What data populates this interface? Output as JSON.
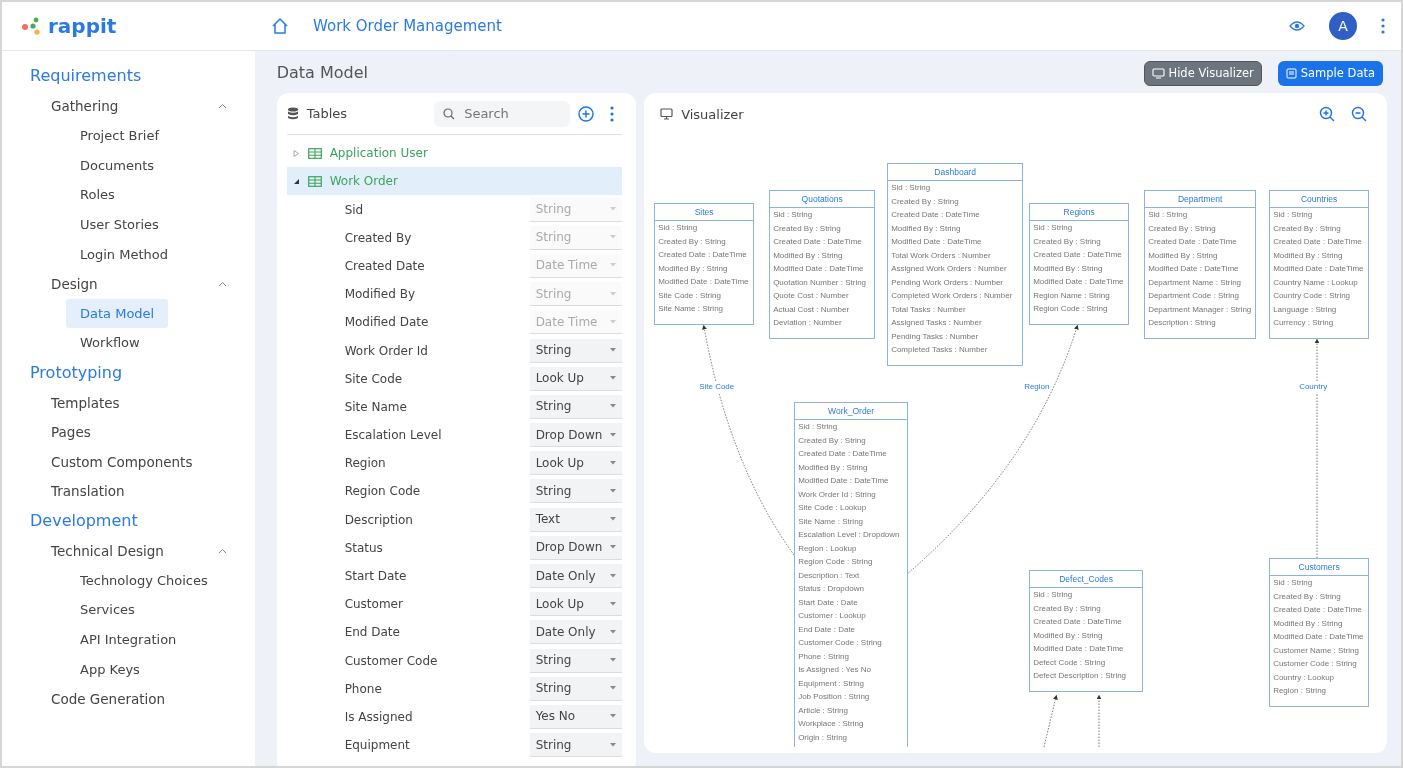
{
  "app": {
    "brand": "rappit",
    "project": "Work Order Management",
    "avatar": "A"
  },
  "sidebar": {
    "sections": [
      {
        "title": "Requirements",
        "items": [
          {
            "label": "Gathering",
            "expanded": true,
            "children": [
              {
                "label": "Project Brief",
                "selected": false
              },
              {
                "label": "Documents",
                "selected": false
              },
              {
                "label": "Roles",
                "selected": false
              },
              {
                "label": "User Stories",
                "selected": false
              },
              {
                "label": "Login Method",
                "selected": false
              }
            ]
          },
          {
            "label": "Design",
            "expanded": true,
            "children": [
              {
                "label": "Data Model",
                "selected": true
              },
              {
                "label": "Workflow",
                "selected": false
              }
            ]
          }
        ]
      },
      {
        "title": "Prototyping",
        "items": [
          {
            "label": "Templates",
            "selected": false
          },
          {
            "label": "Pages",
            "selected": false
          },
          {
            "label": "Custom Components",
            "selected": false
          },
          {
            "label": "Translation",
            "selected": false
          }
        ]
      },
      {
        "title": "Development",
        "items": [
          {
            "label": "Technical Design",
            "expanded": true,
            "children": [
              {
                "label": "Technology Choices",
                "selected": false
              },
              {
                "label": "Services",
                "selected": false
              },
              {
                "label": "API Integration",
                "selected": false
              },
              {
                "label": "App Keys",
                "selected": false
              }
            ]
          },
          {
            "label": "Code Generation",
            "selected": false
          }
        ]
      }
    ]
  },
  "page_title": "Data Model",
  "buttons": [
    {
      "label": "Hide Visualizer",
      "kind": "secondary"
    },
    {
      "label": "Sample Data",
      "kind": "primary"
    }
  ],
  "tables_panel": {
    "title": "Tables",
    "search": {
      "placeholder": "Search"
    },
    "tables": [
      {
        "name": "Application User",
        "expanded": false,
        "selected": false
      },
      {
        "name": "Work Order",
        "expanded": true,
        "selected": true,
        "fields": [
          {
            "name": "Sid",
            "type": "String",
            "disabled": true
          },
          {
            "name": "Created By",
            "type": "String",
            "disabled": true
          },
          {
            "name": "Created Date",
            "type": "Date Time",
            "disabled": true
          },
          {
            "name": "Modified By",
            "type": "String",
            "disabled": true
          },
          {
            "name": "Modified Date",
            "type": "Date Time",
            "disabled": true
          },
          {
            "name": "Work Order Id",
            "type": "String",
            "disabled": false
          },
          {
            "name": "Site Code",
            "type": "Look Up",
            "disabled": false
          },
          {
            "name": "Site Name",
            "type": "String",
            "disabled": false
          },
          {
            "name": "Escalation Level",
            "type": "Drop Down",
            "disabled": false
          },
          {
            "name": "Region",
            "type": "Look Up",
            "disabled": false
          },
          {
            "name": "Region Code",
            "type": "String",
            "disabled": false
          },
          {
            "name": "Description",
            "type": "Text",
            "disabled": false
          },
          {
            "name": "Status",
            "type": "Drop Down",
            "disabled": false
          },
          {
            "name": "Start Date",
            "type": "Date Only",
            "disabled": false
          },
          {
            "name": "Customer",
            "type": "Look Up",
            "disabled": false
          },
          {
            "name": "End Date",
            "type": "Date Only",
            "disabled": false
          },
          {
            "name": "Customer Code",
            "type": "String",
            "disabled": false
          },
          {
            "name": "Phone",
            "type": "String",
            "disabled": false
          },
          {
            "name": "Is Assigned",
            "type": "Yes No",
            "disabled": false
          },
          {
            "name": "Equipment",
            "type": "String",
            "disabled": false
          }
        ]
      }
    ]
  },
  "visualizer": {
    "title": "Visualizer",
    "entities": [
      {
        "name": "Sites",
        "attributes": [
          "Sid : String",
          "Created By : String",
          "Created Date : DateTime",
          "Modified By : String",
          "Modified Date : DateTime",
          "Site Code : String",
          "Site Name : String"
        ]
      },
      {
        "name": "Quotations",
        "attributes": [
          "Sid : String",
          "Created By : String",
          "Created Date : DateTime",
          "Modified By : String",
          "Modified Date : DateTime",
          "Quotation Number : String",
          "Quote Cost : Number",
          "Actual Cost : Number",
          "Deviation : Number"
        ]
      },
      {
        "name": "Dashboard",
        "attributes": [
          "Sid : String",
          "Created By : String",
          "Created Date : DateTime",
          "Modified By : String",
          "Modified Date : DateTime",
          "Total Work Orders : Number",
          "Assigned Work Orders : Number",
          "Pending Work Orders : Number",
          "Completed Work Orders : Number",
          "Total Tasks : Number",
          "Assigned Tasks : Number",
          "Pending Tasks : Number",
          "Completed Tasks : Number"
        ]
      },
      {
        "name": "Regions",
        "attributes": [
          "Sid : String",
          "Created By : String",
          "Created Date : DateTime",
          "Modified By : String",
          "Modified Date : DateTime",
          "Region Name : String",
          "Region Code : String"
        ]
      },
      {
        "name": "Department",
        "attributes": [
          "Sid : String",
          "Created By : String",
          "Created Date : DateTime",
          "Modified By : String",
          "Modified Date : DateTime",
          "Department Name : String",
          "Department Code : String",
          "Department Manager : String",
          "Description : String"
        ]
      },
      {
        "name": "Countries",
        "attributes": [
          "Sid : String",
          "Created By : String",
          "Created Date : DateTime",
          "Modified By : String",
          "Modified Date : DateTime",
          "Country Name : Lookup",
          "Country Code : String",
          "Language : String",
          "Currency : String"
        ]
      },
      {
        "name": "Work_Order",
        "attributes": [
          "Sid : String",
          "Created By : String",
          "Created Date : DateTime",
          "Modified By : String",
          "Modified Date : DateTime",
          "Work Order Id : String",
          "Site Code : Lookup",
          "Site Name : String",
          "Escalation Level : Dropdown",
          "Region : Lookup",
          "Region Code : String",
          "Description : Text",
          "Status : Dropdown",
          "Start Date : Date",
          "Customer : Lookup",
          "End Date : Date",
          "Customer Code : String",
          "Phone : String",
          "Is Assigned : Yes No",
          "Equipment : String",
          "Job Position : String",
          "Article : String",
          "Workplace : String",
          "Origin : String"
        ]
      },
      {
        "name": "Defect_Codes",
        "attributes": [
          "Sid : String",
          "Created By : String",
          "Created Date : DateTime",
          "Modified By : String",
          "Modified Date : DateTime",
          "Defect Code : String",
          "Defect Description : String"
        ]
      },
      {
        "name": "Customers",
        "attributes": [
          "Sid : String",
          "Created By : String",
          "Created Date : DateTime",
          "Modified By : String",
          "Modified Date : DateTime",
          "Customer Name : String",
          "Customer Code : String",
          "Country : Lookup",
          "Region : String"
        ]
      }
    ],
    "link_labels": [
      "Site Code",
      "Region",
      "Country"
    ]
  }
}
